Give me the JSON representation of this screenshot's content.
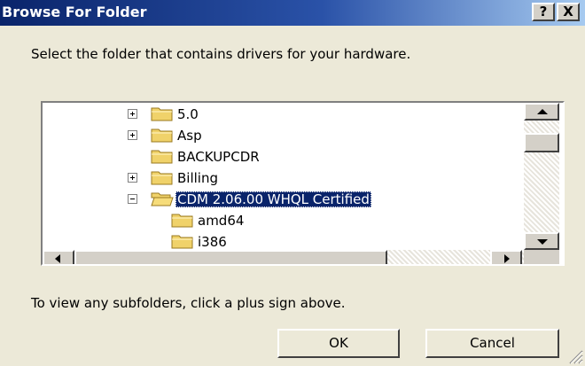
{
  "window": {
    "title": "Browse For Folder",
    "help_label": "?",
    "close_label": "X"
  },
  "instruction": "Select the folder that contains drivers for your hardware.",
  "tree": {
    "items": [
      {
        "label": "5.0",
        "expander": "plus",
        "selected": false
      },
      {
        "label": "Asp",
        "expander": "plus",
        "selected": false
      },
      {
        "label": "BACKUPCDR",
        "expander": "none",
        "selected": false
      },
      {
        "label": "Billing",
        "expander": "plus",
        "selected": false
      },
      {
        "label": "CDM 2.06.00 WHQL Certified",
        "expander": "minus",
        "selected": true
      },
      {
        "label": "amd64",
        "expander": "none",
        "selected": false
      },
      {
        "label": "i386",
        "expander": "none",
        "selected": false
      }
    ]
  },
  "hint": "To view any subfolders, click a plus sign above.",
  "buttons": {
    "ok": "OK",
    "cancel": "Cancel"
  },
  "colors": {
    "title_bar": "#0a246a",
    "selection": "#0a246a",
    "folder": "#f0d26a",
    "dialog_bg": "#ece9d8"
  }
}
